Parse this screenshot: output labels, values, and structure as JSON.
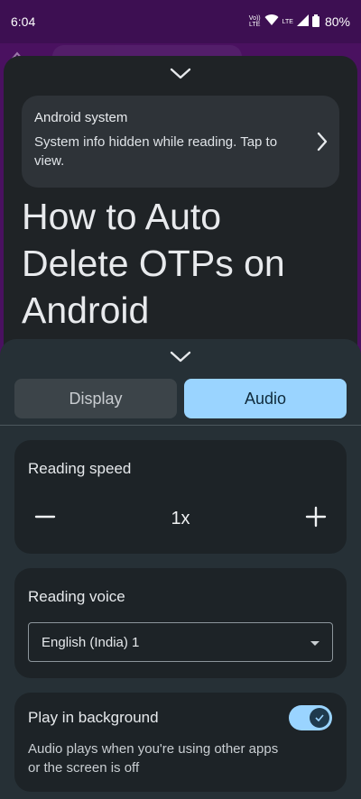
{
  "status_bar": {
    "time": "6:04",
    "volte_top": "Vo))",
    "volte_bottom": "LTE",
    "network": "LTE",
    "battery": "80%"
  },
  "notice": {
    "title": "Android system",
    "body": "System info hidden while reading. Tap to view."
  },
  "article": {
    "title": "How to Auto Delete OTPs on Android"
  },
  "settings": {
    "tabs": [
      {
        "label": "Display",
        "selected": false
      },
      {
        "label": "Audio",
        "selected": true
      }
    ],
    "reading_speed": {
      "label": "Reading speed",
      "value": "1x"
    },
    "reading_voice": {
      "label": "Reading voice",
      "selected": "English (India) 1"
    },
    "play_in_background": {
      "label": "Play in background",
      "description": "Audio plays when you're using other apps or the screen is off",
      "enabled": true
    }
  },
  "icons": {
    "collapse": "chevron-down-icon",
    "notice_open": "chevron-right-icon",
    "decrease": "minus-icon",
    "increase": "plus-icon",
    "dropdown": "dropdown-arrow-icon",
    "toggle_check": "check-icon"
  },
  "colors": {
    "accent": "#9ad4ff",
    "sheet": "#1f2326",
    "panel": "#263036",
    "status_bar": "#3d0f52"
  }
}
